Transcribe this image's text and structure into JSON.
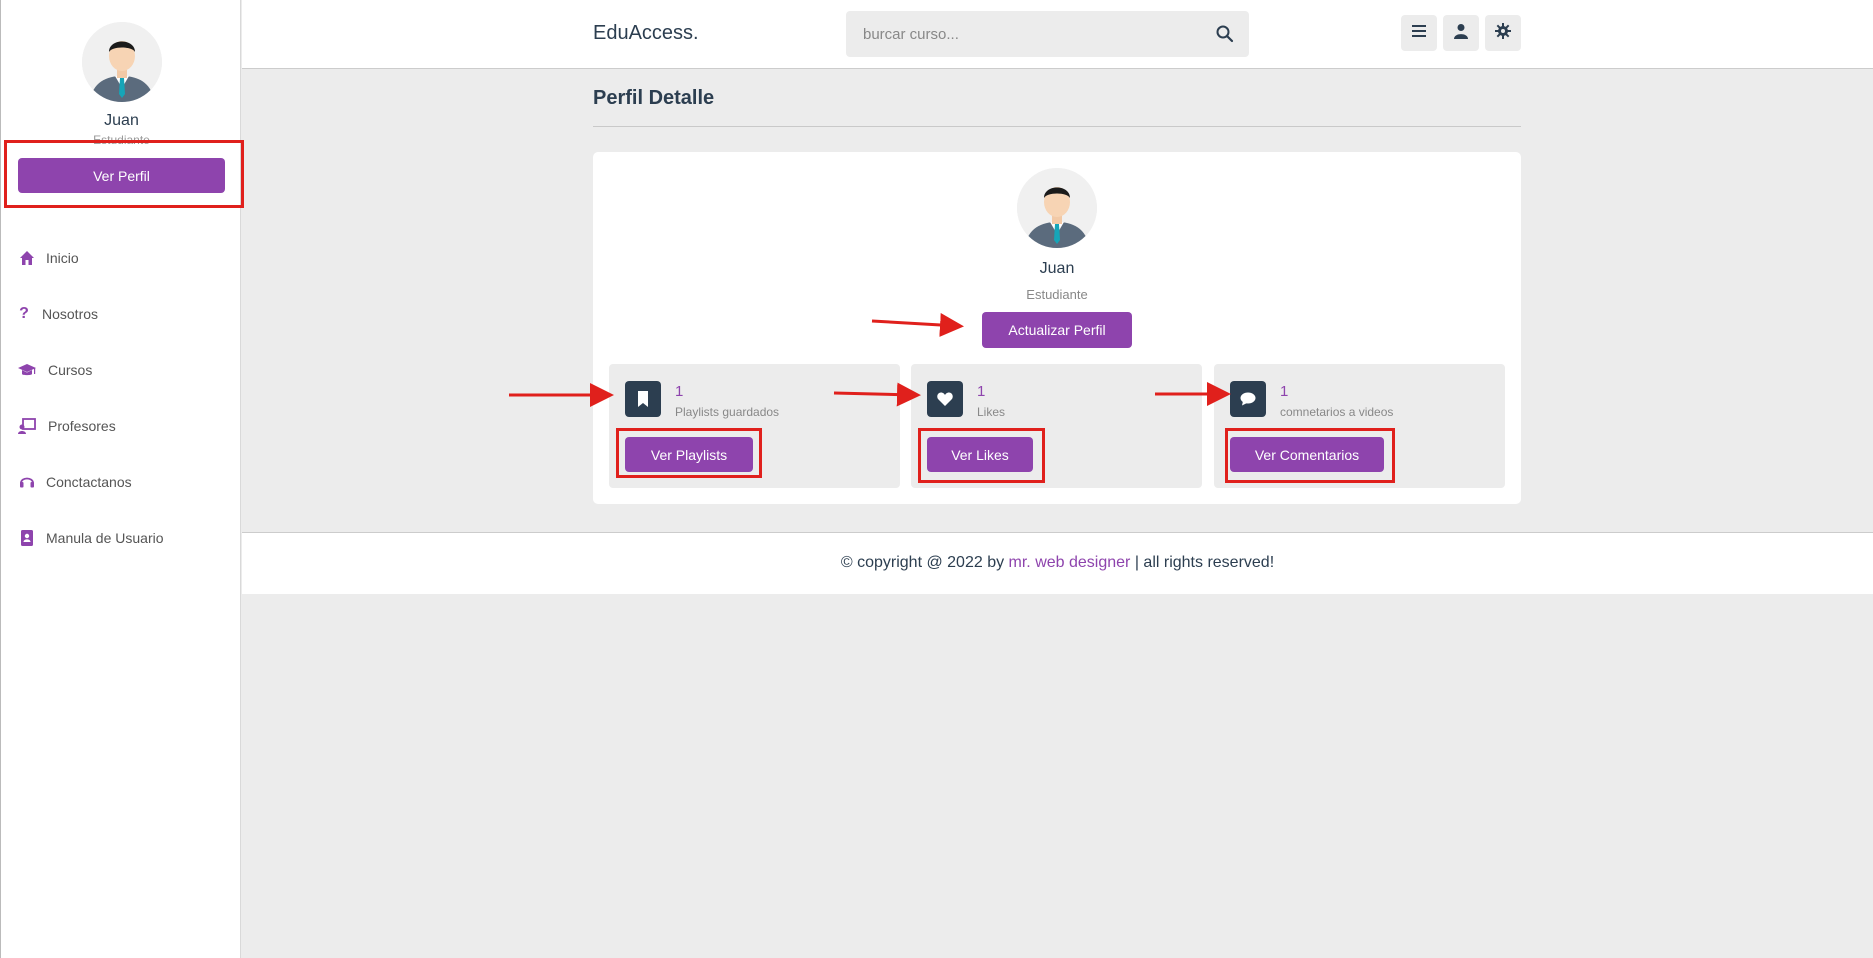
{
  "sidebar": {
    "user_name": "Juan",
    "user_role": "Estudiante",
    "profile_button": "Ver Perfil",
    "items": [
      {
        "label": "Inicio",
        "icon": "home-icon"
      },
      {
        "label": "Nosotros",
        "icon": "question-icon"
      },
      {
        "label": "Cursos",
        "icon": "graduation-cap-icon"
      },
      {
        "label": "Profesores",
        "icon": "chalkboard-teacher-icon"
      },
      {
        "label": "Conctactanos",
        "icon": "headset-icon"
      },
      {
        "label": "Manula de Usuario",
        "icon": "address-book-icon"
      }
    ]
  },
  "header": {
    "logo": "EduAccess.",
    "search_placeholder": "burcar curso...",
    "buttons": [
      "menu-icon",
      "user-icon",
      "gear-icon"
    ]
  },
  "main": {
    "title": "Perfil Detalle",
    "profile": {
      "name": "Juan",
      "role": "Estudiante",
      "update_button": "Actualizar Perfil"
    },
    "stats": [
      {
        "icon": "bookmark-icon",
        "count": "1",
        "label": "Playlists guardados",
        "button": "Ver Playlists"
      },
      {
        "icon": "heart-icon",
        "count": "1",
        "label": "Likes",
        "button": "Ver Likes"
      },
      {
        "icon": "comment-icon",
        "count": "1",
        "label": "comnetarios a videos",
        "button": "Ver Comentarios"
      }
    ]
  },
  "footer": {
    "prefix": "© copyright @ 2022 by ",
    "link": "mr. web designer",
    "suffix": " | all rights reserved!"
  },
  "colors": {
    "accent": "#8e44ad",
    "dark": "#2c3e50",
    "background": "#ececec",
    "annotation": "#e0201c"
  }
}
